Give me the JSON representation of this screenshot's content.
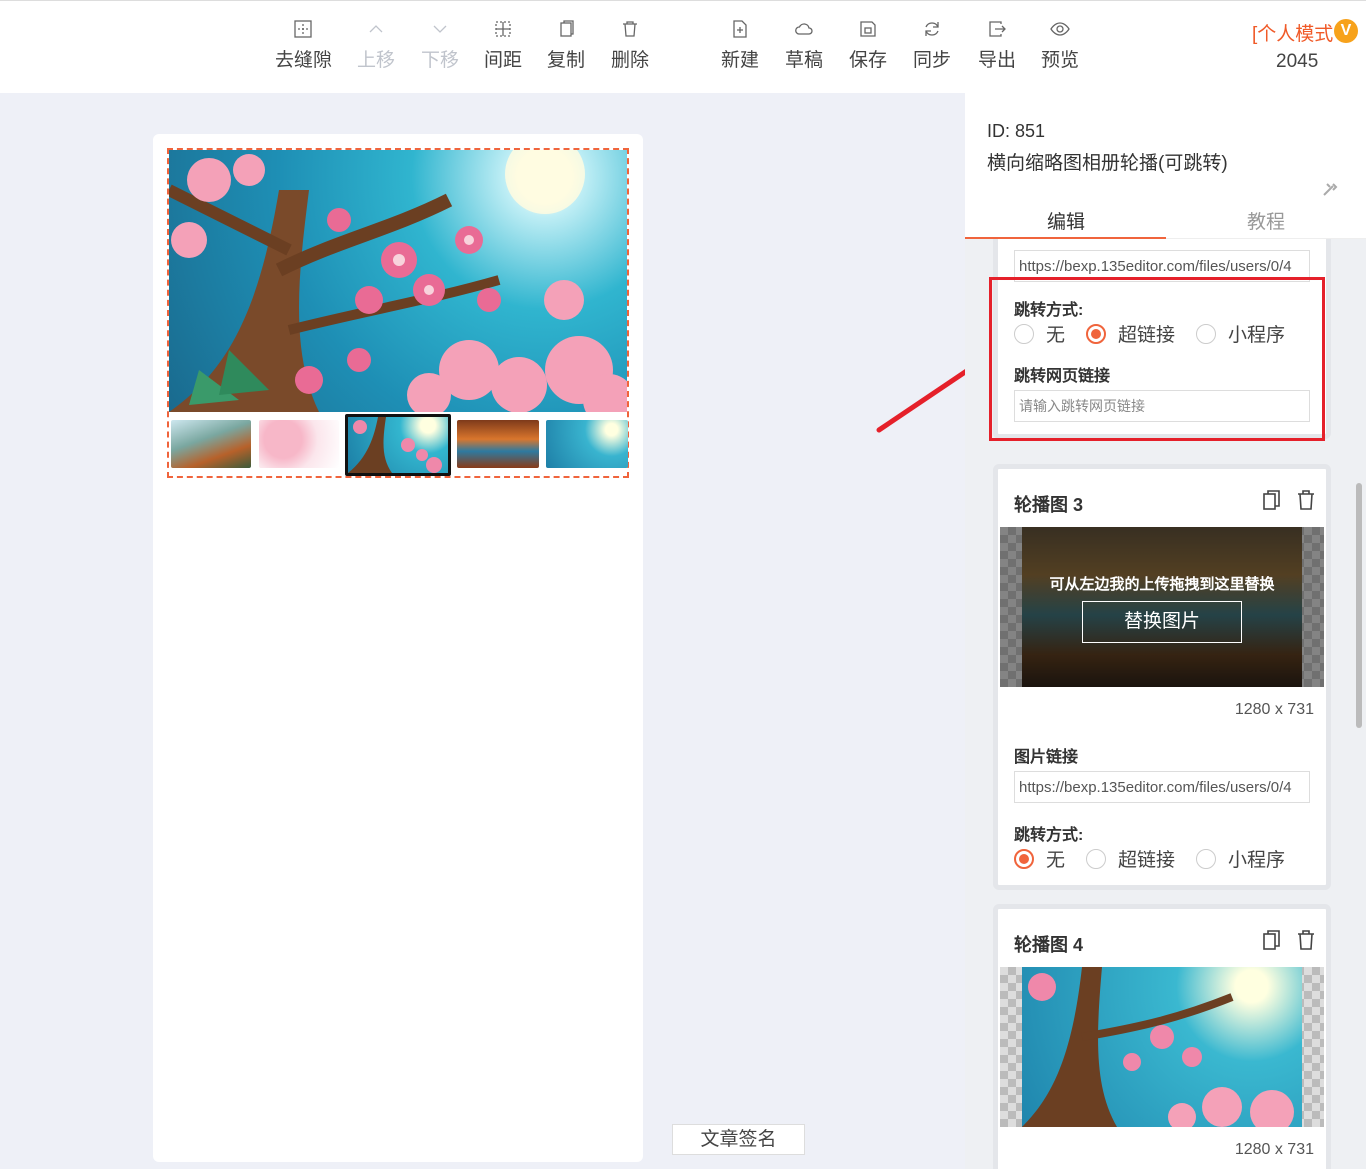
{
  "toolbar": {
    "buttons": [
      {
        "label": "去缝隙",
        "icon": "remove-gap-icon",
        "disabled": false
      },
      {
        "label": "上移",
        "icon": "chevron-up-icon",
        "disabled": true
      },
      {
        "label": "下移",
        "icon": "chevron-down-icon",
        "disabled": true
      },
      {
        "label": "间距",
        "icon": "spacing-icon",
        "disabled": false
      },
      {
        "label": "复制",
        "icon": "copy-icon",
        "disabled": false
      },
      {
        "label": "删除",
        "icon": "trash-icon",
        "disabled": false
      },
      {
        "label": "新建",
        "icon": "new-file-icon",
        "disabled": false
      },
      {
        "label": "草稿",
        "icon": "cloud-icon",
        "disabled": false
      },
      {
        "label": "保存",
        "icon": "save-icon",
        "disabled": false
      },
      {
        "label": "同步",
        "icon": "sync-icon",
        "disabled": false
      },
      {
        "label": "导出",
        "icon": "export-icon",
        "disabled": false
      },
      {
        "label": "预览",
        "icon": "eye-icon",
        "disabled": false
      }
    ],
    "mode_label": "[个人模式",
    "vip_badge": "V",
    "mode_number": "2045"
  },
  "canvas": {
    "signature_button": "文章签名"
  },
  "panel": {
    "id_label": "ID: 851",
    "template_name": "横向缩略图相册轮播(可跳转)",
    "tabs": [
      {
        "label": "编辑",
        "active": true
      },
      {
        "label": "教程",
        "active": false
      }
    ],
    "card2": {
      "image_link_value": "https://bexp.135editor.com/files/users/0/4",
      "jump_mode_label": "跳转方式:",
      "jump_options": [
        "无",
        "超链接",
        "小程序"
      ],
      "jump_selected": "超链接",
      "web_link_label": "跳转网页链接",
      "web_link_placeholder": "请输入跳转网页链接"
    },
    "card3": {
      "title": "轮播图 3",
      "overlay_hint": "可从左边我的上传拖拽到这里替换",
      "replace_button": "替换图片",
      "dims": "1280 x 731",
      "image_link_label": "图片链接",
      "image_link_value": "https://bexp.135editor.com/files/users/0/4",
      "jump_mode_label": "跳转方式:",
      "jump_options": [
        "无",
        "超链接",
        "小程序"
      ],
      "jump_selected": "无"
    },
    "card4": {
      "title": "轮播图 4",
      "dims": "1280 x 731"
    }
  },
  "colors": {
    "accent": "#f0643c",
    "highlight": "#e5202a",
    "vip": "#f7a21b"
  }
}
